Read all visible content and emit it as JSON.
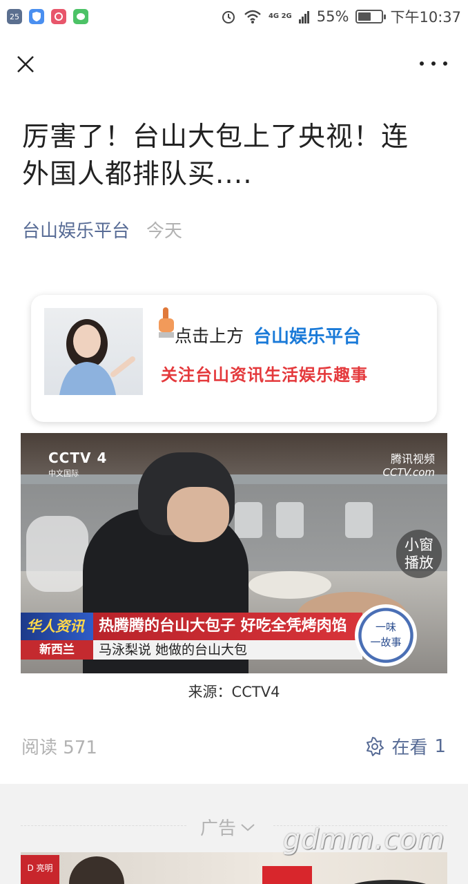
{
  "status_bar": {
    "app_badge": "25",
    "network": "4G 2G",
    "battery_percent": "55%",
    "battery_level": 0.55,
    "time": "下午10:37"
  },
  "nav": {
    "close_icon": "close-icon",
    "more_icon": "more-icon"
  },
  "article": {
    "title_line1": "厉害了！台山大包上了央视！连",
    "title_line2": "外国人都排队买....",
    "account": "台山娱乐平台",
    "date": "今天"
  },
  "follow_card": {
    "prefix": "点击上方",
    "account": "台山娱乐平台",
    "slogan": "关注台山资讯生活娱乐趣事"
  },
  "video": {
    "channel_logo": "CCTV 4",
    "channel_sub": "中文国际",
    "platform_logo": "腾讯视频",
    "platform_sub": "CCTV.com",
    "mini_window_line1": "小窗",
    "mini_window_line2": "播放",
    "brand": "华人资讯",
    "headline": "热腾腾的台山大包子 好吃全凭烤肉馅",
    "region": "新西兰",
    "subline": "马泳梨说 她做的台山大包",
    "badge_line1": "一味",
    "badge_line2": "一故事",
    "caption": "来源：CCTV4"
  },
  "stats": {
    "reads_label": "阅读",
    "reads_count": "571",
    "watching_label": "在看",
    "watching_count": "1"
  },
  "ad": {
    "label": "广告",
    "logo_text": "D 亮明"
  },
  "watermark": "gdmm.com"
}
